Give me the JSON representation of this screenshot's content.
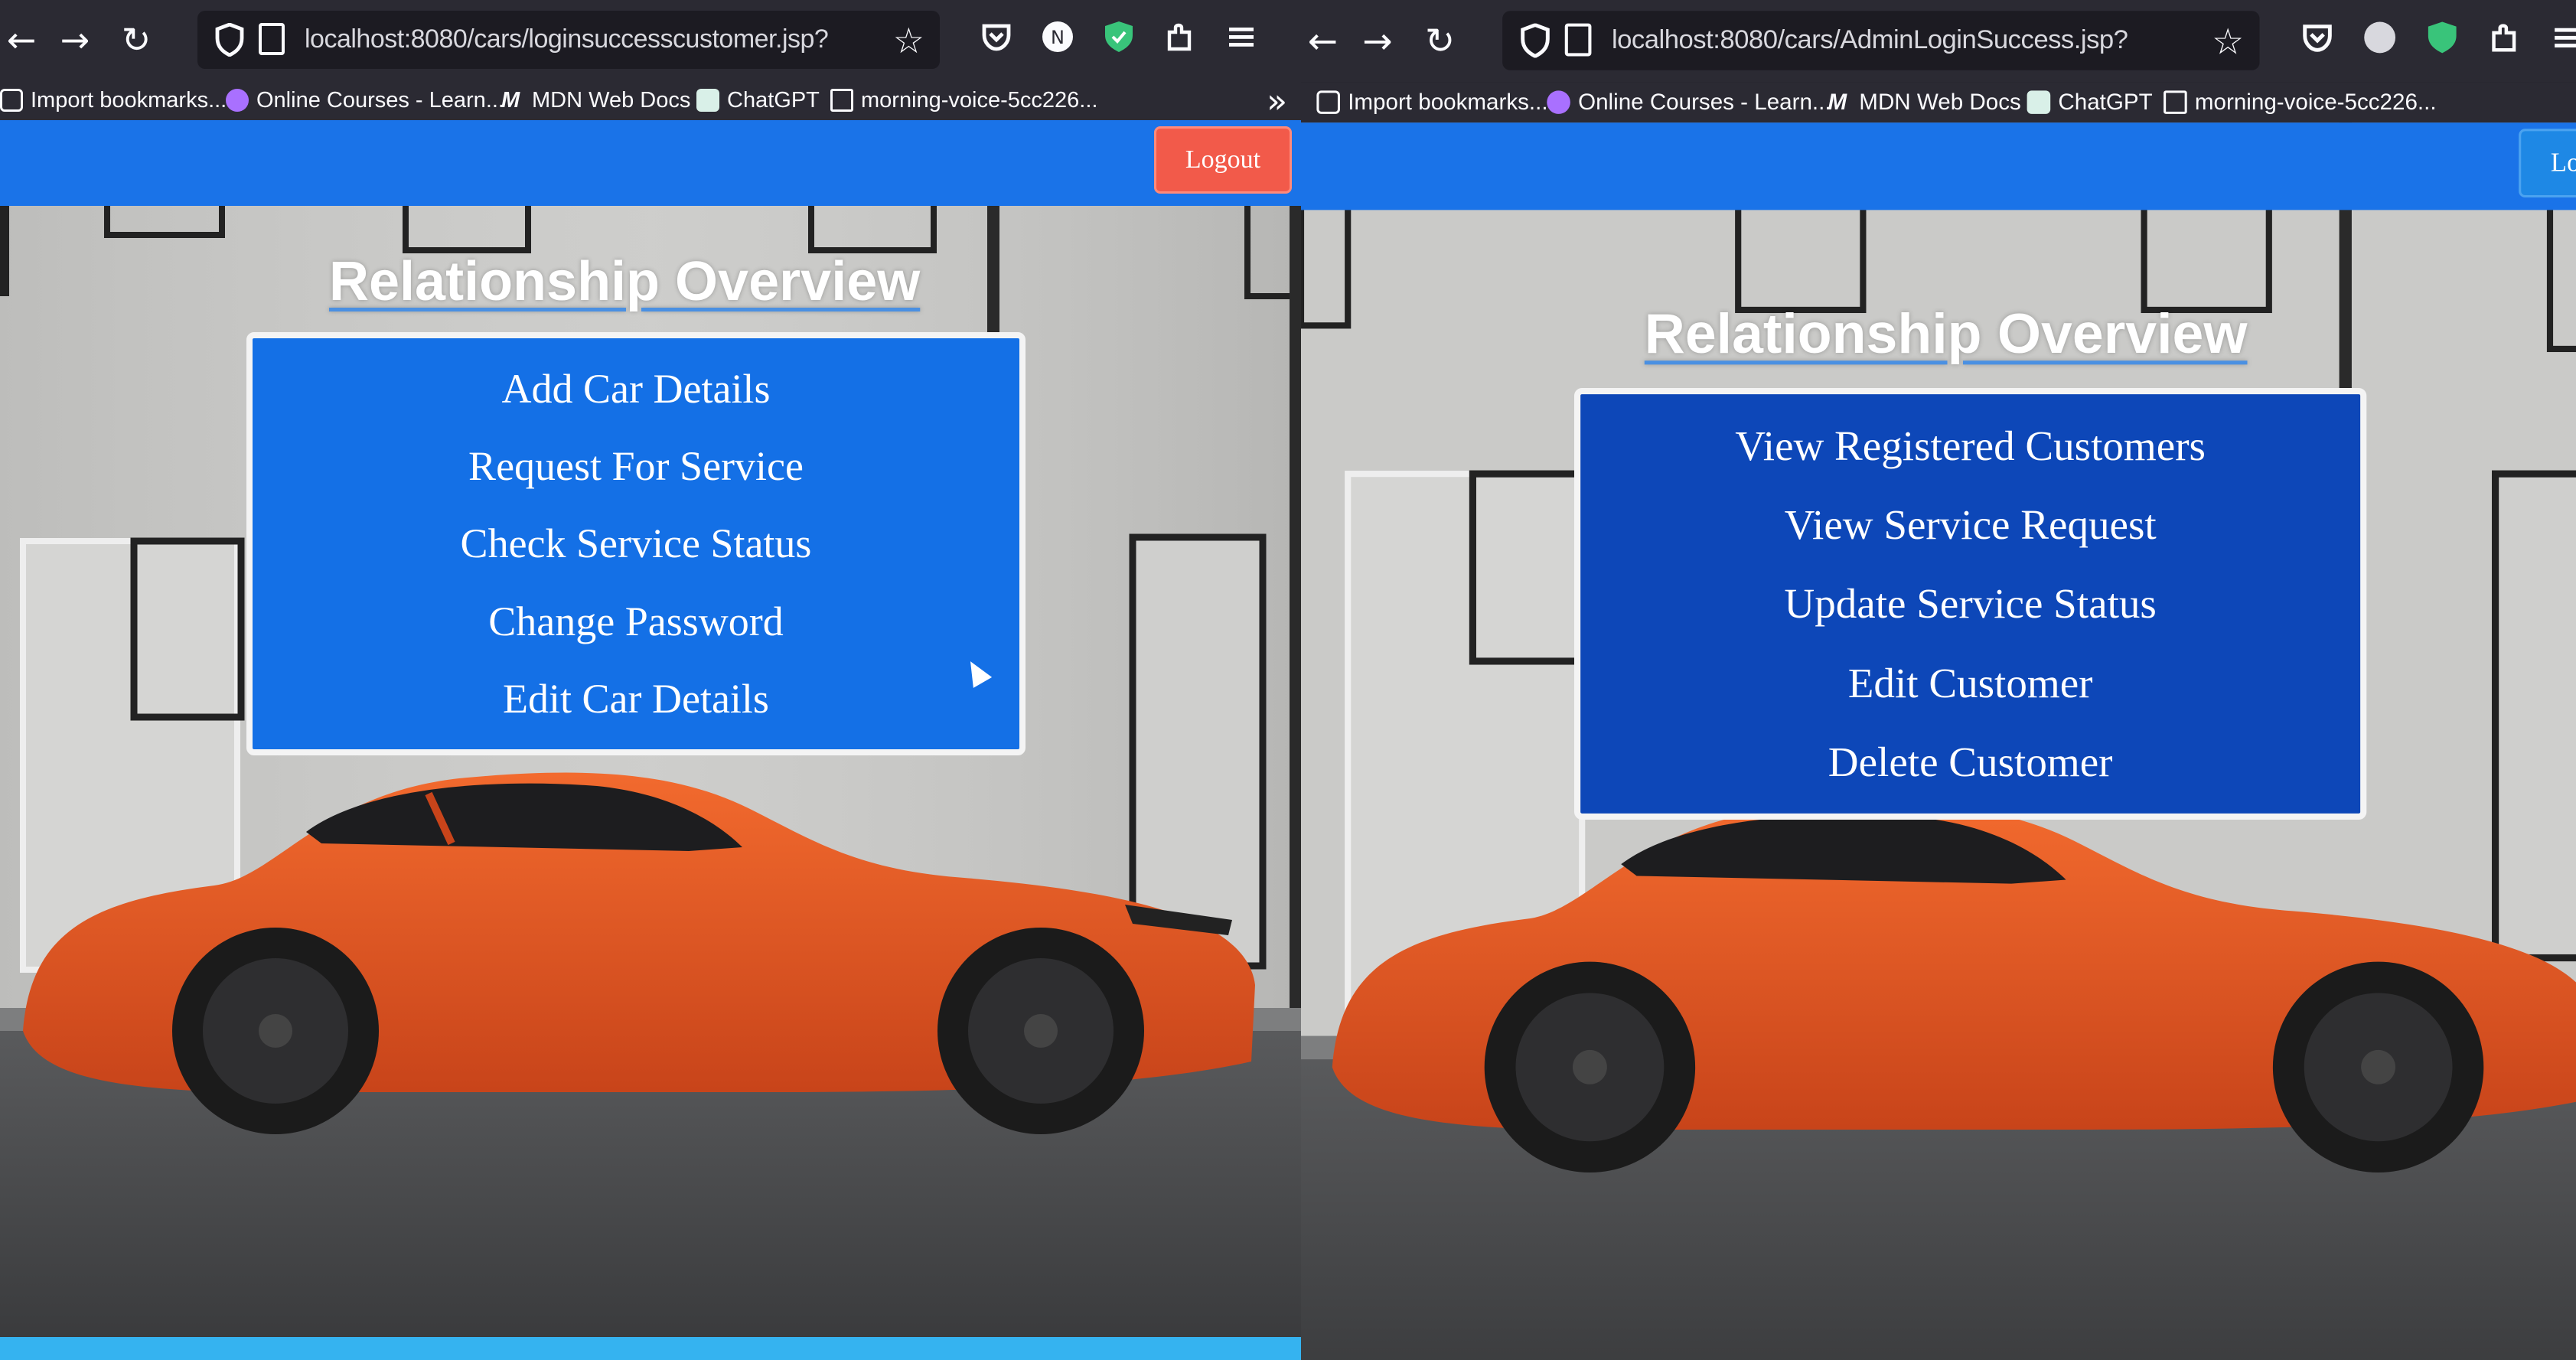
{
  "customer": {
    "url": "localhost:8080/cars/loginsuccesscustomer.jsp?",
    "bookmarks": [
      "Import bookmarks...",
      "Online Courses - Learn...",
      "MDN Web Docs",
      "ChatGPT",
      "morning-voice-5cc226..."
    ],
    "logout_label": "Logout",
    "title": "Relationship Overview",
    "menu": [
      "Add Car Details",
      "Request For Service",
      "Check Service Status",
      "Change Password",
      "Edit Car Details"
    ],
    "menu_color": "#1470e6"
  },
  "admin": {
    "url": "localhost:8080/cars/AdminLoginSuccess.jsp?",
    "bookmarks": [
      "Import bookmarks...",
      "Online Courses - Learn...",
      "MDN Web Docs",
      "ChatGPT",
      "morning-voice-5cc226..."
    ],
    "logout_label": "Logout",
    "title": "Relationship Overview",
    "menu": [
      "View Registered Customers",
      "View Service Request",
      "Update Service Status",
      "Edit Customer",
      "Delete Customer"
    ],
    "menu_color": "#0d47b8"
  },
  "icons": [
    "back-arrow-icon",
    "forward-arrow-icon",
    "reload-icon",
    "shield-icon",
    "page-icon",
    "star-icon",
    "pocket-icon",
    "account-icon",
    "extension-shield-icon",
    "extensions-icon",
    "menu-icon"
  ],
  "colors": {
    "header_blue": "#1a73e8",
    "logout_red": "#f25a4a",
    "car_orange": "#e8551c"
  }
}
